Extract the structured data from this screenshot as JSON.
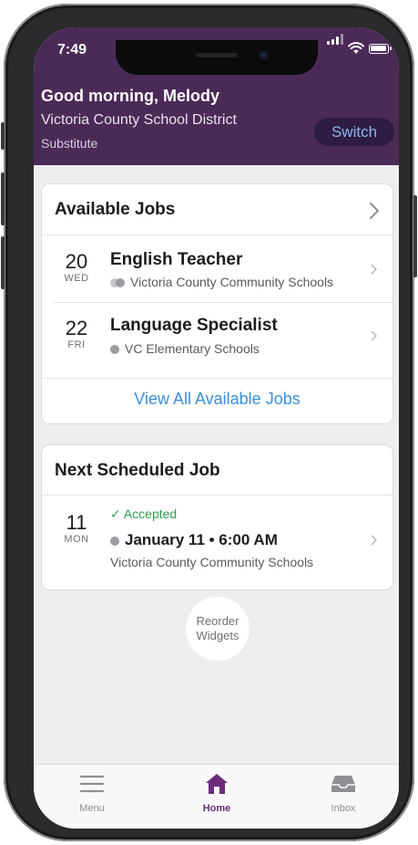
{
  "status": {
    "time": "7:49"
  },
  "header": {
    "greeting": "Good morning, Melody",
    "district": "Victoria County School District",
    "role": "Substitute",
    "switch_label": "Switch"
  },
  "available_jobs": {
    "title": "Available Jobs",
    "jobs": [
      {
        "day": "20",
        "dow": "WED",
        "title": "English Teacher",
        "location": "Victoria County Community Schools"
      },
      {
        "day": "22",
        "dow": "FRI",
        "title": "Language Specialist",
        "location": "VC Elementary Schools"
      }
    ],
    "view_all_label": "View All Available Jobs"
  },
  "next_job": {
    "title": "Next Scheduled Job",
    "day": "11",
    "dow": "MON",
    "status": "✓ Accepted",
    "when": "January 11 • 6:00 AM",
    "location": "Victoria County Community Schools"
  },
  "reorder": {
    "line1": "Reorder",
    "line2": "Widgets"
  },
  "tabbar": {
    "tabs": [
      {
        "label": "Menu",
        "icon": "menu-icon"
      },
      {
        "label": "Home",
        "icon": "home-icon",
        "active": true
      },
      {
        "label": "Inbox",
        "icon": "inbox-icon"
      }
    ]
  },
  "colors": {
    "header": "#4b2a57",
    "accent": "#6a2c7a",
    "link": "#3a8fd9",
    "accepted": "#2e9e4c"
  }
}
